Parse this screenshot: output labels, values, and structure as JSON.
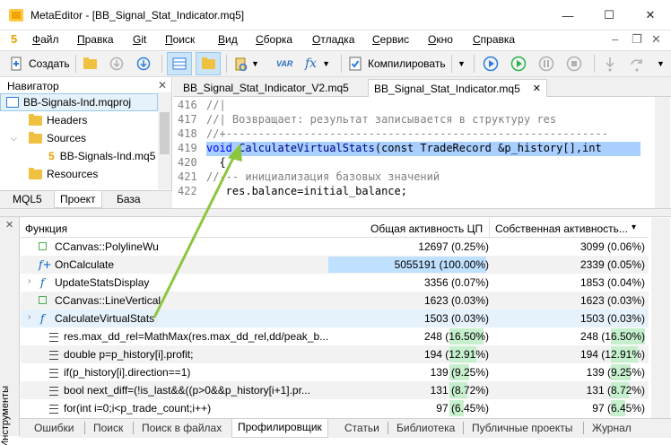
{
  "window": {
    "title": "MetaEditor - [BB_Signal_Stat_Indicator.mq5]",
    "minimize": "—",
    "maximize": "☐",
    "close": "✕"
  },
  "menu": {
    "logo": "5",
    "items": [
      "Файл",
      "Правка",
      "Git",
      "Поиск",
      "Вид",
      "Сборка",
      "Отладка",
      "Сервис",
      "Окно",
      "Справка"
    ],
    "controls": [
      "–",
      "❐",
      "✕"
    ]
  },
  "toolbar": {
    "create": "Создать",
    "compile": "Компилировать",
    "var_label": "VAR",
    "fx_label": "fx"
  },
  "navigator": {
    "title": "Навигатор",
    "close": "✕",
    "items": [
      {
        "label": "BB-Signals-Ind.mqproj"
      },
      {
        "label": "Headers"
      },
      {
        "label": "Sources"
      },
      {
        "label": "BB-Signals-Ind.mq5"
      },
      {
        "label": "Resources"
      }
    ],
    "tabs": [
      "MQL5",
      "Проект",
      "База"
    ],
    "active_tab": "Проект"
  },
  "editor": {
    "tabs": [
      "BB_Signal_Stat_Indicator_V2.mq5",
      "BB_Signal_Stat_Indicator.mq5"
    ],
    "active_tab": "BB_Signal_Stat_Indicator.mq5",
    "tab_close": "✕",
    "lines": [
      {
        "n": "416",
        "text": "//|"
      },
      {
        "n": "417",
        "text": "//| Возвращает: результат записывается в структуру res"
      },
      {
        "n": "418",
        "text": "//+-----------------------------------------------------------"
      },
      {
        "n": "419",
        "kw": "void",
        "fn": " CalculateVirtualStats",
        "rest": "(const TradeRecord &p_history[],int"
      },
      {
        "n": "420",
        "text": "  {"
      },
      {
        "n": "421",
        "text": "//--- инициализация базовых значений"
      },
      {
        "n": "422",
        "text": "   res.balance=initial_balance;"
      }
    ]
  },
  "profiler": {
    "columns": {
      "function": "Функция",
      "total": "Общая активность ЦП",
      "self": "Собственная активность...",
      "sort": "▾"
    },
    "rows": [
      {
        "name": "CCanvas::PolylineWu",
        "total": "12697 (0.25%)",
        "self": "3099 (0.06%)",
        "total_pct": 0.25,
        "self_pct": 0.06
      },
      {
        "name": "OnCalculate",
        "total": "5055191 (100.00%)",
        "self": "2339 (0.05%)",
        "total_pct": 100.0,
        "self_pct": 0.05
      },
      {
        "name": "UpdateStatsDisplay",
        "total": "3356 (0.07%)",
        "self": "1853 (0.04%)",
        "total_pct": 0.07,
        "self_pct": 0.04
      },
      {
        "name": "CCanvas::LineVertical",
        "total": "1623 (0.03%)",
        "self": "1623 (0.03%)",
        "total_pct": 0.03,
        "self_pct": 0.03
      },
      {
        "name": "CalculateVirtualStats",
        "total": "1503 (0.03%)",
        "self": "1503 (0.03%)",
        "total_pct": 0.03,
        "self_pct": 0.03
      },
      {
        "name": "res.max_dd_rel=MathMax(res.max_dd_rel,dd/peak_b...",
        "total": "248 (16.50%)",
        "self": "248 (16.50%)",
        "total_pct": 16.5,
        "self_pct": 16.5
      },
      {
        "name": "double p=p_history[i].profit;",
        "total": "194 (12.91%)",
        "self": "194 (12.91%)",
        "total_pct": 12.91,
        "self_pct": 12.91
      },
      {
        "name": "if(p_history[i].direction==1)",
        "total": "139 (9.25%)",
        "self": "139 (9.25%)",
        "total_pct": 9.25,
        "self_pct": 9.25
      },
      {
        "name": "bool next_diff=(!is_last&&((p>0&&p_history[i+1].pr...",
        "total": "131 (8.72%)",
        "self": "131 (8.72%)",
        "total_pct": 8.72,
        "self_pct": 8.72
      },
      {
        "name": "for(int i=0;i<p_trade_count;i++)",
        "total": "97 (6.45%)",
        "self": "97 (6.45%)",
        "total_pct": 6.45,
        "self_pct": 6.45
      }
    ]
  },
  "tools": {
    "label": "Инструменты",
    "close": "✕"
  },
  "bottom_tabs": [
    "Ошибки",
    "Поиск",
    "Поиск в файлах",
    "Профилировщик",
    "Статьи",
    "Библиотека",
    "Публичные проекты",
    "Журнал"
  ],
  "active_bottom_tab": "Профилировщик",
  "colors": {
    "selection": "#a8cfff",
    "cpu_bar": "#bfe0ff",
    "pct_bar": "#c6efce",
    "arrow": "#8cc63f",
    "accent": "#0078d7"
  }
}
